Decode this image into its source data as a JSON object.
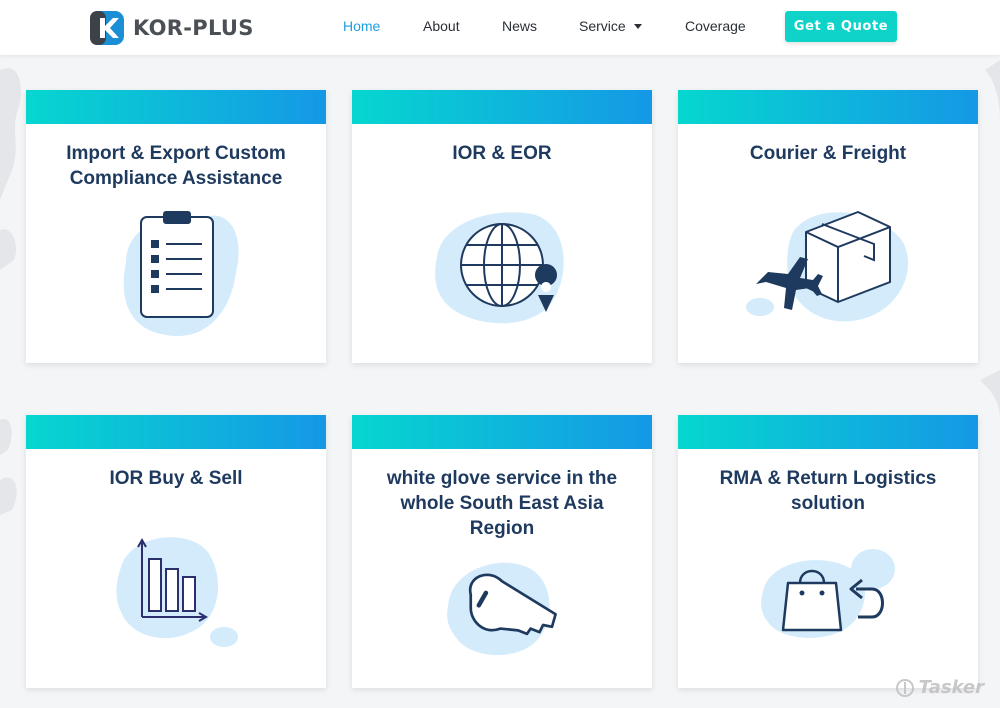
{
  "brand": {
    "name": "KOR-PLUS"
  },
  "nav": {
    "home": "Home",
    "about": "About",
    "news": "News",
    "service": "Service",
    "coverage": "Coverage",
    "cta": "Get a Quote"
  },
  "services": [
    {
      "title": "Import & Export Custom Compliance Assistance",
      "icon": "clipboard-icon"
    },
    {
      "title": "IOR & EOR",
      "icon": "globe-pin-icon"
    },
    {
      "title": "Courier & Freight",
      "icon": "plane-box-icon"
    },
    {
      "title": "IOR Buy & Sell",
      "icon": "bar-chart-icon"
    },
    {
      "title": "white glove service in the whole South East Asia Region",
      "icon": "key-icon"
    },
    {
      "title": "RMA & Return Logistics solution",
      "icon": "bag-return-icon"
    }
  ],
  "watermark": "Tasker",
  "colors": {
    "accent": "#1d9fe0",
    "button": "#0fd3c9",
    "gradient_start": "#06d7cf",
    "gradient_end": "#1598e6",
    "heading": "#1f3a5f",
    "blob": "#d3ebfb",
    "icon_stroke": "#1f3a5f"
  }
}
